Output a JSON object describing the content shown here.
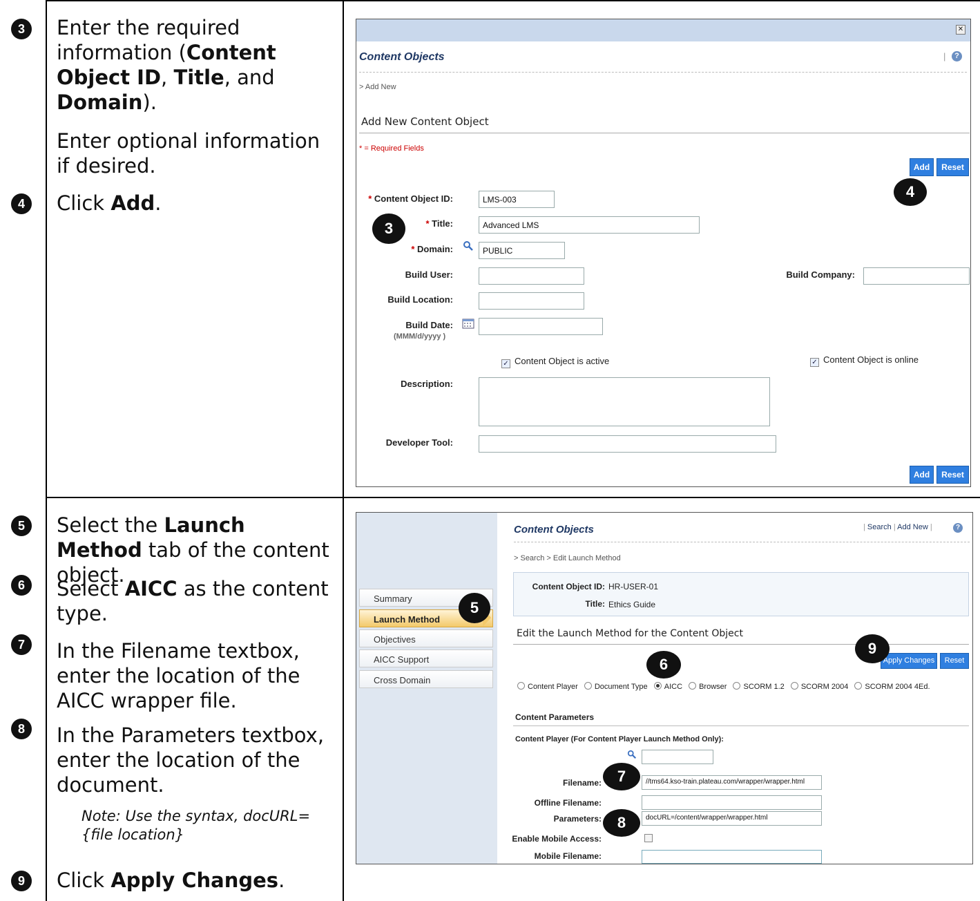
{
  "row1": {
    "steps": [
      {
        "num": "3",
        "text_html": "Enter the required information (<b>Content Object ID</b>, <b>Title</b>, and <b>Domain</b>)."
      },
      {
        "text": "Enter optional information if desired."
      },
      {
        "num": "4",
        "text_html": "Click <b>Add</b>."
      }
    ]
  },
  "dialog": {
    "close_glyph": "✕",
    "title": "Content Objects",
    "help_glyph": "?",
    "separator": "|",
    "breadcrumb": "> Add New",
    "heading": "Add New Content Object",
    "required_note": "* = Required Fields",
    "add_label": "Add",
    "reset_label": "Reset",
    "asterisk": "*",
    "fields": {
      "content_object_id": {
        "label": "Content Object ID:",
        "value": "LMS-003"
      },
      "title": {
        "label": "Title:",
        "value": "Advanced LMS"
      },
      "domain": {
        "label": "Domain:",
        "value": "PUBLIC"
      },
      "build_user": {
        "label": "Build User:",
        "value": ""
      },
      "build_company": {
        "label": "Build Company:",
        "value": ""
      },
      "build_location": {
        "label": "Build Location:",
        "value": ""
      },
      "build_date": {
        "label": "Build Date:",
        "hint": "(MMM/d/yyyy )",
        "value": ""
      },
      "active": {
        "label": "Content Object is active",
        "checked": true
      },
      "online": {
        "label": "Content Object is online",
        "checked": true
      },
      "description": {
        "label": "Description:",
        "value": ""
      },
      "developer_tool": {
        "label": "Developer Tool:",
        "value": ""
      }
    },
    "callouts": {
      "add": "4",
      "fields": "3"
    }
  },
  "row2": {
    "steps": [
      {
        "num": "5",
        "text_html": "Select the <b>Launch Method</b> tab of the content object."
      },
      {
        "num": "6",
        "text_html": "Select <b>AICC</b> as the content type."
      },
      {
        "num": "7",
        "text": "In the Filename textbox, enter the location of the AICC wrapper file."
      },
      {
        "num": "8",
        "text": "In the Parameters textbox, enter the location of the document."
      },
      {
        "note": "Note: Use the syntax, docURL={file location}"
      },
      {
        "num": "9",
        "text_html": "Click <b>Apply Changes</b>."
      }
    ]
  },
  "launch": {
    "title": "Content Objects",
    "top_links": {
      "search": "Search",
      "add_new": "Add New",
      "sep": "|"
    },
    "help_glyph": "?",
    "breadcrumb": "> Search > Edit Launch Method",
    "id_label": "Content Object ID:",
    "id_value": "HR-USER-01",
    "title_label": "Title:",
    "title_value": "Ethics Guide",
    "tabs": [
      "Summary",
      "Launch Method",
      "Objectives",
      "AICC Support",
      "Cross Domain"
    ],
    "heading": "Edit the Launch Method for the Content Object",
    "apply_label": "Apply Changes",
    "reset_label": "Reset",
    "radios": [
      {
        "label": "Content Player",
        "selected": false
      },
      {
        "label": "Document Type",
        "selected": false
      },
      {
        "label": "AICC",
        "selected": true
      },
      {
        "label": "Browser",
        "selected": false
      },
      {
        "label": "SCORM 1.2",
        "selected": false
      },
      {
        "label": "SCORM 2004",
        "selected": false
      },
      {
        "label": "SCORM 2004 4Ed.",
        "selected": false
      }
    ],
    "params_heading": "Content Parameters",
    "player_label": "Content Player (For Content Player Launch Method Only):",
    "filename_label": "Filename:",
    "filename_value": "//tms64.kso-train.plateau.com/wrapper/wrapper.html",
    "offline_label": "Offline Filename:",
    "parameters_label": "Parameters:",
    "parameters_value": "docURL=/content/wrapper/wrapper.html",
    "mobile_access_label": "Enable Mobile Access:",
    "mobile_filename_label": "Mobile Filename:",
    "callouts": {
      "tab": "5",
      "radio": "6",
      "filename": "7",
      "parameters": "8",
      "apply": "9"
    }
  },
  "colors": {
    "accent_blue": "#2f7fe0",
    "header_blue": "#c9d8ec",
    "title_navy": "#1f3864"
  }
}
